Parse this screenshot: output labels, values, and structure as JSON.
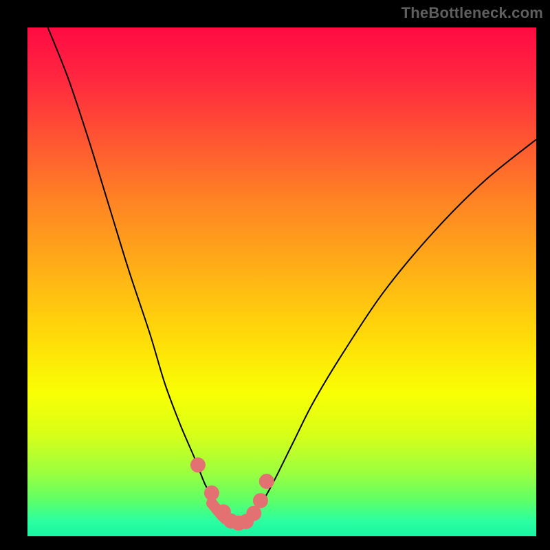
{
  "watermark": "TheBottleneck.com",
  "colors": {
    "frame_bg": "#000000",
    "line": "#000000",
    "dots": "#e37171",
    "gradient_start": "#ff0b43",
    "gradient_end": "#18f5a3"
  },
  "chart_data": {
    "type": "line",
    "title": "",
    "xlabel": "",
    "ylabel": "",
    "xlim": [
      0,
      100
    ],
    "ylim": [
      0,
      100
    ],
    "grid": false,
    "legend": false,
    "series": [
      {
        "name": "bottleneck-curve",
        "x": [
          4,
          8,
          12,
          16,
          20,
          24,
          27,
          30,
          33,
          35,
          37,
          39,
          40,
          41.5,
          43,
          45,
          48,
          52,
          56,
          62,
          70,
          80,
          90,
          100
        ],
        "y": [
          100,
          90,
          78,
          65,
          52,
          40,
          30,
          22,
          15,
          10,
          7,
          4.5,
          3,
          2.1,
          3,
          5,
          10,
          18,
          26,
          36,
          48,
          60,
          70,
          78
        ]
      }
    ],
    "dot_series": {
      "name": "highlight-dots",
      "x": [
        33.5,
        36.2,
        38.5,
        40.0,
        41.5,
        43.0,
        44.5,
        45.8,
        47.0
      ],
      "y": [
        14.0,
        8.5,
        4.8,
        3.0,
        2.6,
        2.9,
        4.5,
        7.0,
        10.8
      ]
    },
    "dot_line": {
      "name": "valley-highlight",
      "x": [
        36.2,
        38.5,
        40.0,
        41.5,
        43.0,
        44.5
      ],
      "y": [
        6.5,
        3.8,
        2.8,
        2.6,
        3.0,
        4.5
      ]
    }
  }
}
